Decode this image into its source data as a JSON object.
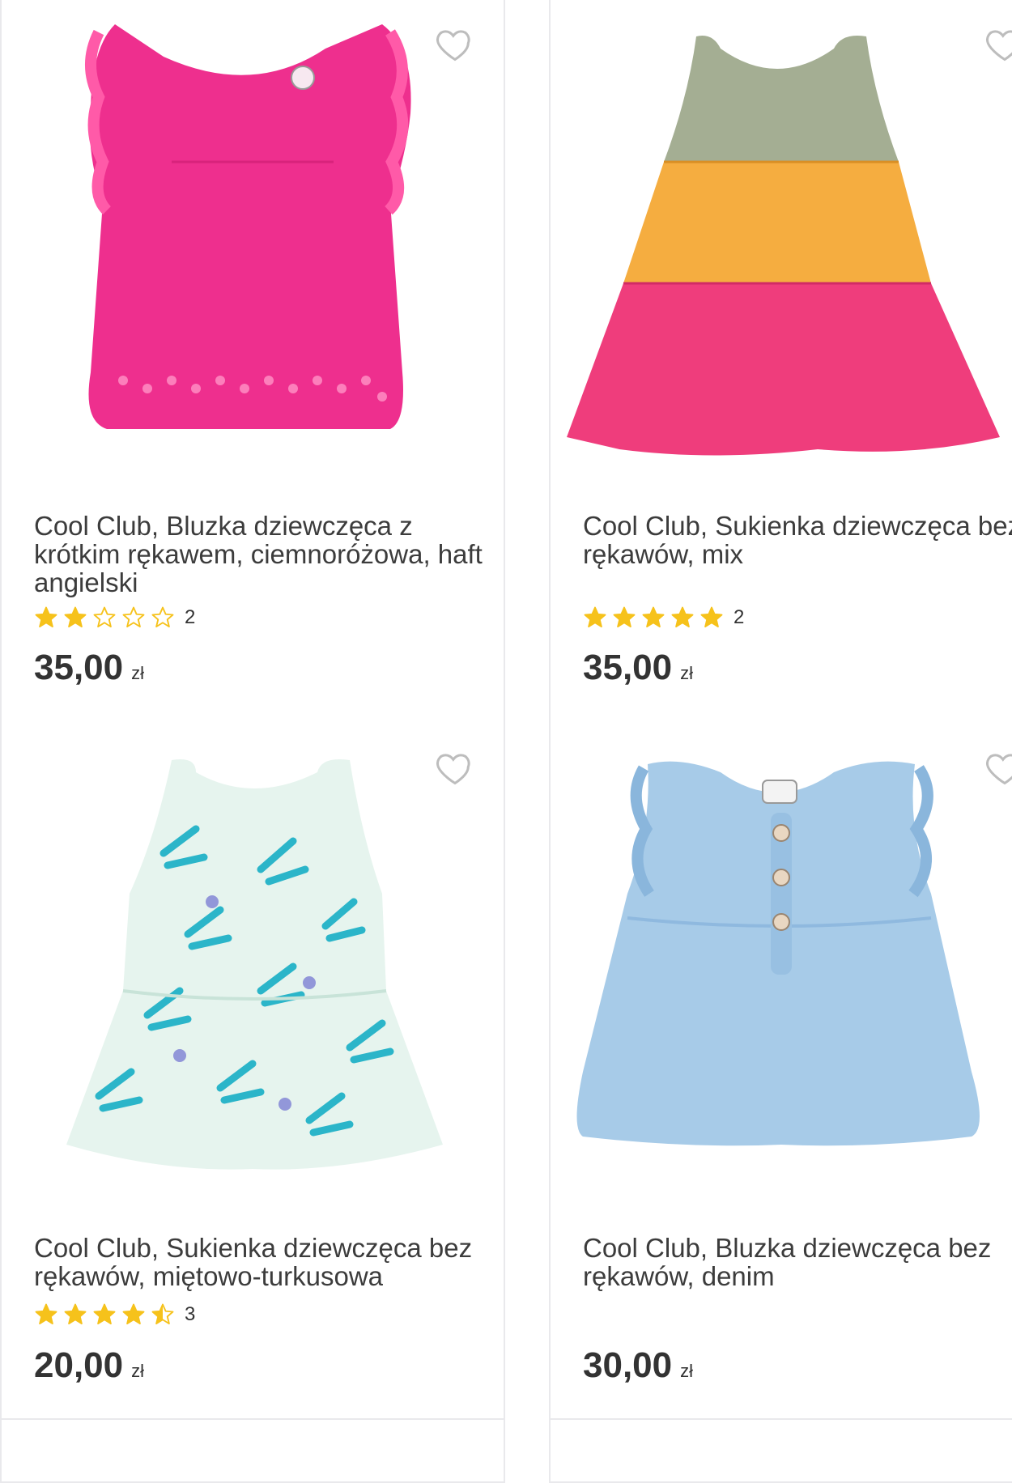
{
  "colors": {
    "star": "#f6c21b",
    "heart": "#bdbdbd",
    "divider": "#e9e9ec"
  },
  "products": [
    {
      "title": "Cool Club, Bluzka dziewczęca z krótkim rękawem, ciemnoróżowa, haft angielski",
      "rating": 2,
      "review_count": "2",
      "price": "35,00",
      "currency": "zł"
    },
    {
      "title": "Cool Club, Sukienka dziewczęca bez rękawów, mix",
      "rating": 5,
      "review_count": "2",
      "price": "35,00",
      "currency": "zł"
    },
    {
      "title": "Cool Club, Sukienka dziewczęca bez rękawów, miętowo-turkusowa",
      "rating": 4.5,
      "review_count": "3",
      "price": "20,00",
      "currency": "zł"
    },
    {
      "title": "Cool Club, Bluzka dziewczęca bez rękawów, denim",
      "rating": null,
      "review_count": "",
      "price": "30,00",
      "currency": "zł"
    }
  ]
}
